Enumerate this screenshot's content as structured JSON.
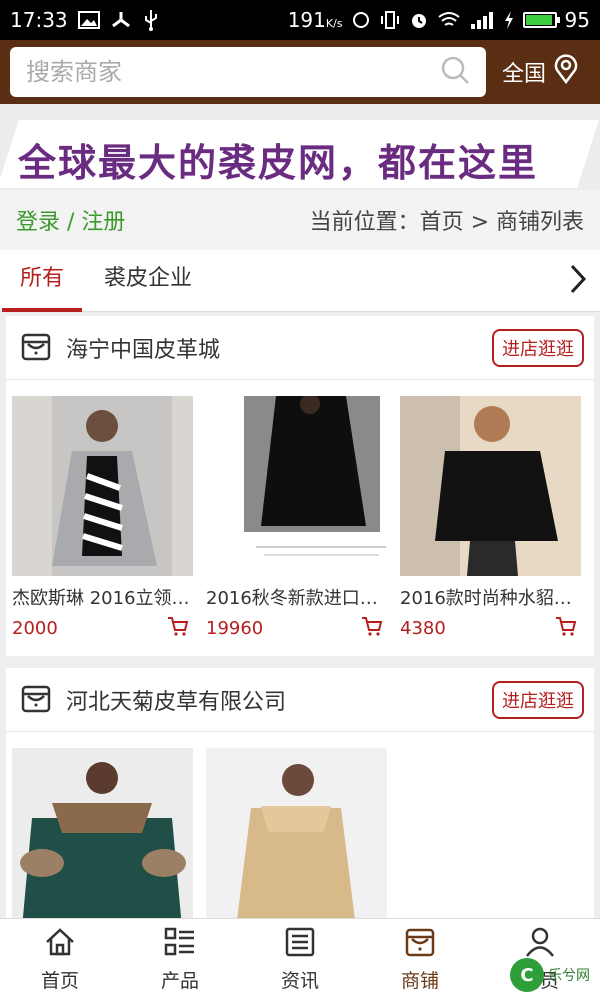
{
  "status_bar": {
    "time": "17:33",
    "net_speed": "191",
    "net_speed_unit": "K/s",
    "battery": "95",
    "battery_level": 0.95,
    "signal": "4G"
  },
  "search": {
    "placeholder": "搜索商家",
    "region_label": "全国"
  },
  "banner": {
    "text": "全球最大的裘皮网，都在这里"
  },
  "info": {
    "login_label": "登录 / 注册",
    "breadcrumb": "当前位置：首页 > 商铺列表"
  },
  "tabs": [
    {
      "label": "所有",
      "active": true
    },
    {
      "label": "裘皮企业",
      "active": false
    }
  ],
  "shops": [
    {
      "name": "海宁中国皮革城",
      "enter_label": "进店逛逛",
      "products": [
        {
          "name": "杰欧斯琳 2016立领…",
          "price": "2000"
        },
        {
          "name": "2016秋冬新款进口…",
          "price": "19960"
        },
        {
          "name": "2016款时尚种水貂…",
          "price": "4380"
        }
      ]
    },
    {
      "name": "河北天菊皮草有限公司",
      "enter_label": "进店逛逛",
      "products": [
        {
          "name": "",
          "price": ""
        },
        {
          "name": "",
          "price": ""
        }
      ]
    }
  ],
  "bottom_nav": [
    {
      "label": "首页",
      "icon": "home-icon"
    },
    {
      "label": "产品",
      "icon": "list-icon"
    },
    {
      "label": "资讯",
      "icon": "news-icon"
    },
    {
      "label": "商铺",
      "icon": "shop-icon",
      "active": true
    },
    {
      "label": "会员",
      "icon": "user-icon"
    }
  ],
  "watermark": {
    "text": "乐兮网"
  },
  "colors": {
    "header_bg": "#5a2e13",
    "accent_red": "#b5201e",
    "login_green": "#3b9a2c",
    "banner_purple": "#6a2c80"
  }
}
